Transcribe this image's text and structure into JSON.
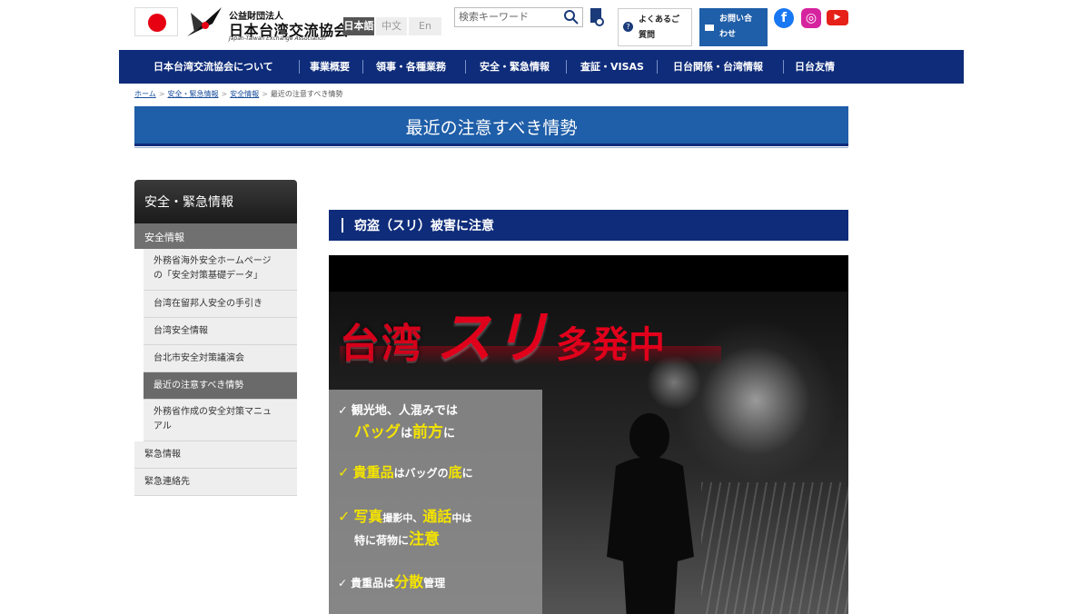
{
  "header": {
    "org_sub": "公益財団法人",
    "org_name": "日本台湾交流協会",
    "org_en": "Japan-Taiwan Exchange Association",
    "languages": [
      "日本語",
      "中文",
      "En"
    ],
    "search_placeholder": "検索キーワード",
    "faq_label_1": "よくあるご",
    "faq_label_2": "質問",
    "contact_label_1": "お問い合",
    "contact_label_2": "わせ",
    "sns": [
      "facebook-icon",
      "instagram-icon",
      "youtube-icon"
    ]
  },
  "nav": [
    "日本台湾交流協会について",
    "事業概要",
    "領事・各種業務",
    "安全・緊急情報",
    "査証・VISAS",
    "日台関係・台湾情報",
    "日台友情"
  ],
  "breadcrumb": [
    "ホーム",
    "安全・緊急情報",
    "安全情報",
    "最近の注意すべき情勢"
  ],
  "page_title": "最近の注意すべき情勢",
  "sidebar": {
    "heading": "安全・緊急情報",
    "section": "安全情報",
    "items": [
      {
        "line1": "外務省海外安全ホームページ",
        "line2": "の「安全対策基礎データ」"
      },
      {
        "line1": "台湾在留邦人安全の手引き",
        "line2": ""
      },
      {
        "line1": "台湾安全情報",
        "line2": ""
      },
      {
        "line1": "台北市安全対策議演会",
        "line2": ""
      },
      {
        "line1": "最近の注意すべき情勢",
        "line2": ""
      },
      {
        "line1": "外務省作成の安全対策マニュ",
        "line2": "アル"
      }
    ],
    "top_items": [
      "緊急情報",
      "緊急連絡先"
    ]
  },
  "section_heading": "窃盗（スリ）被害に注意",
  "poster": {
    "headline_1": "台湾",
    "headline_2": "スリ",
    "headline_3": "多発中",
    "tips": [
      {
        "a": "観光地、人混みでは",
        "b_y": "バッグ",
        "b": "は",
        "b2_y": "前方",
        "b2": "に"
      },
      {
        "a_y": "貴重品",
        "a": "はバッグの",
        "a2_y": "底",
        "a2": "に"
      },
      {
        "a_y": "写真",
        "a": "撮影中、",
        "a2_y": "通話",
        "a2": "中は",
        "b": "特に荷物に",
        "b_y": "注意"
      },
      {
        "a": "貴重品は",
        "a_y": "分散",
        "a2": "管理"
      }
    ]
  },
  "colors": {
    "nav_bg": "#0e2c7a",
    "title_bg": "#1f5ea8",
    "sidebar_head": "#2a2a2a",
    "poster_red": "#e1001b",
    "poster_yellow": "#f5e400"
  }
}
